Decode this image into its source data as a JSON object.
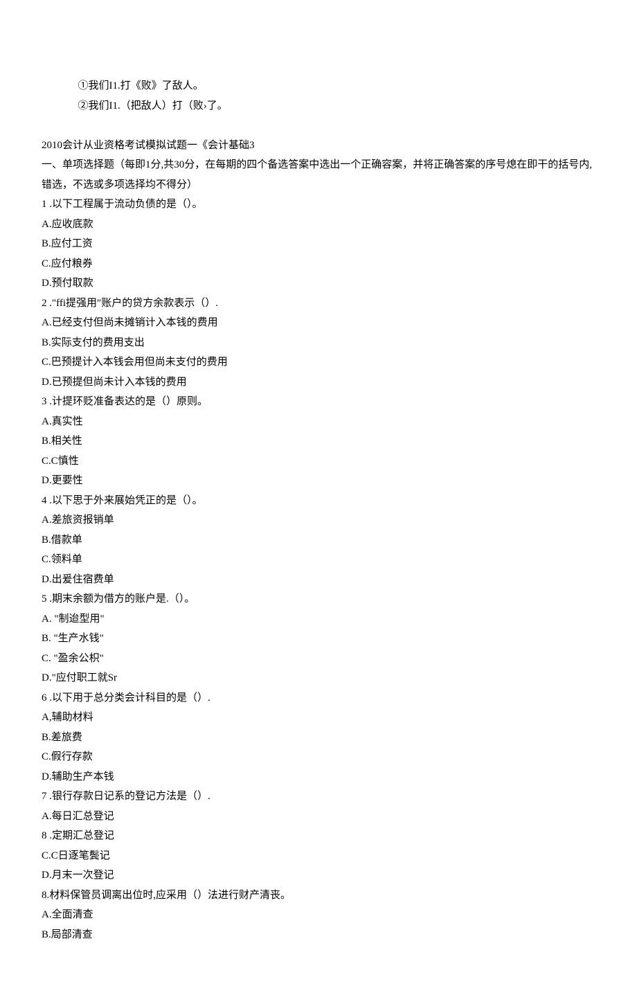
{
  "top_lines": [
    "①我们I1.打《败》了敌人。",
    "②我们I1.（把敌人）打（败›了。"
  ],
  "title": "2010会计从业资格考试模拟试题一《会计基础3",
  "section_instr": "一、单项选择题（每即1分,共30分，在每期的四个备选答案中选出一个正确容案，并将正确答案的序号熄在即干的括号内,错选，不选或多项选择均不得分）",
  "q1": {
    "stem": "1 .以下工程属于流动负债的是（）。",
    "a": "A.应收底款",
    "b": "B.应付工资",
    "c": "C.应付粮券",
    "d": "D.预付取款"
  },
  "q2": {
    "stem": "2 .\"ffi提强用″账户的贷方余款表示（）.",
    "a": "A.已经支付但尚未摊销计入本钱的费用",
    "b": "B.实际支付的费用支出",
    "c": "C.巴预提计入本钱会用但尚未支付的费用",
    "d": "D.已预提但尚未计入本钱的费用"
  },
  "q3": {
    "stem": "3 .计提环贬准备表达的是（）原则。",
    "a": "A.真实性",
    "b": "B.相关性",
    "c": "C.C慎性",
    "d": "D.更要性"
  },
  "q4": {
    "stem": "4 .以下思于外来展始凭正的是（）。",
    "a": "A.差旅资报销单",
    "b": "B.借款单",
    "c": "C.领料单",
    "d": "D.出爰住宿费单"
  },
  "q5": {
    "stem": "5 .期末余额为借方的账户是.（）。",
    "a": "A.  \"制迨型用\"",
    "b": "B.  \"生产水钱\"",
    "c": "C.  \"盈余公枳\"",
    "d": "D.\"应付职工就Sr"
  },
  "q6": {
    "stem": "6 .以下用于总分类会计科目的是（）.",
    "a": "A,辅助材料",
    "b": "B.差旅费",
    "c": "C.假行存款",
    "d": "D.辅助生产本钱"
  },
  "q7": {
    "stem": "7 .银行存款日记系的登记方法是（）.",
    "a": "A.每日汇总登记",
    "b": "8 .定期汇总登记",
    "c": "C.C日逐笔鬓记",
    "d": "D.月末一次登记"
  },
  "q8": {
    "stem": "8.材料保管员调离出位时,应采用（）法进行财产清丧。",
    "a": "A.全面清查",
    "b": "B.局部清查"
  }
}
